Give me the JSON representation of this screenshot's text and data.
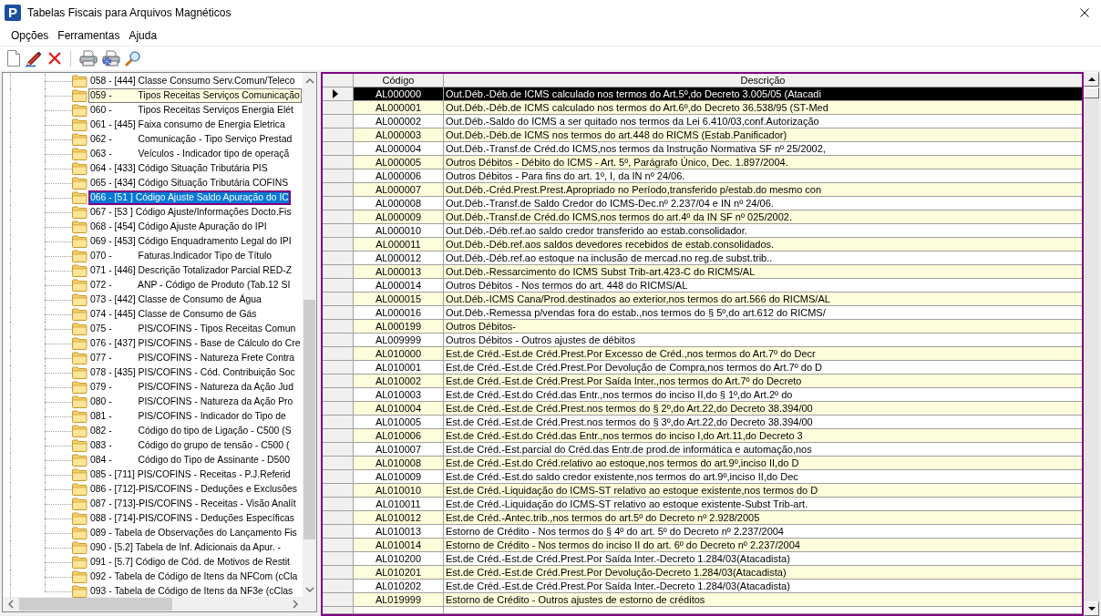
{
  "window": {
    "app_icon_text": "P",
    "title": "Tabelas Fiscais para Arquivos Magnéticos"
  },
  "menu": [
    "Opções",
    "Ferramentas",
    "Ajuda"
  ],
  "tree": {
    "items": [
      {
        "label": "058 - [444] Classe Consumo Serv.Comun/Teleco",
        "selected": false,
        "hovered": false
      },
      {
        "label": "059 -          Tipos Receitas Serviços Comunicação",
        "selected": false,
        "hovered": true
      },
      {
        "label": "060 -          Tipos Receitas Serviços Energia Elét",
        "selected": false,
        "hovered": false
      },
      {
        "label": "061 - [445] Faixa consumo de Energia Eletrica",
        "selected": false,
        "hovered": false
      },
      {
        "label": "062 -          Comunicação - Tipo Serviço Prestad",
        "selected": false,
        "hovered": false
      },
      {
        "label": "063 -          Veículos - Indicador tipo de operaçã",
        "selected": false,
        "hovered": false
      },
      {
        "label": "064 - [433] Código Situação Tributária PIS",
        "selected": false,
        "hovered": false
      },
      {
        "label": "065 - [434] Código Situação Tributária COFINS",
        "selected": false,
        "hovered": false
      },
      {
        "label": "066 - [51 ] Código Ajuste Saldo Apuração do IC",
        "selected": true,
        "hovered": false
      },
      {
        "label": "067 - [53 ] Código Ajuste/Informações Docto.Fis",
        "selected": false,
        "hovered": false
      },
      {
        "label": "068 - [454] Código Ajuste Apuração do IPI",
        "selected": false,
        "hovered": false
      },
      {
        "label": "069 - [453] Código Enquadramento Legal do IPI",
        "selected": false,
        "hovered": false
      },
      {
        "label": "070 -          Faturas.Indicador Tipo de Título",
        "selected": false,
        "hovered": false
      },
      {
        "label": "071 - [446] Descrição Totalizador Parcial RED-Z",
        "selected": false,
        "hovered": false
      },
      {
        "label": "072 -          ANP - Código de Produto (Tab.12 SI",
        "selected": false,
        "hovered": false
      },
      {
        "label": "073 - [442] Classe de Consumo de Água",
        "selected": false,
        "hovered": false
      },
      {
        "label": "074 - [445] Classe de Consumo de Gás",
        "selected": false,
        "hovered": false
      },
      {
        "label": "075 -          PIS/COFINS - Tipos Receitas Comun",
        "selected": false,
        "hovered": false
      },
      {
        "label": "076 - [437] PIS/COFINS - Base de Cálculo do Cre",
        "selected": false,
        "hovered": false
      },
      {
        "label": "077 -          PIS/COFINS - Natureza Frete Contra",
        "selected": false,
        "hovered": false
      },
      {
        "label": "078 - [435] PIS/COFINS - Cód. Contribuição Soc",
        "selected": false,
        "hovered": false
      },
      {
        "label": "079 -          PIS/COFINS - Natureza da Ação Jud",
        "selected": false,
        "hovered": false
      },
      {
        "label": "080 -          PIS/COFINS - Natureza da Ação Pro",
        "selected": false,
        "hovered": false
      },
      {
        "label": "081 -          PIS/COFINS - Indicador do Tipo de",
        "selected": false,
        "hovered": false
      },
      {
        "label": "082 -          Código do tipo de Ligação - C500 (S",
        "selected": false,
        "hovered": false
      },
      {
        "label": "083 -          Código do grupo de tensão - C500 (",
        "selected": false,
        "hovered": false
      },
      {
        "label": "084 -          Código do Tipo de Assinante - D500",
        "selected": false,
        "hovered": false
      },
      {
        "label": "085 - [711] PIS/COFINS - Receitas - P.J.Referid",
        "selected": false,
        "hovered": false
      },
      {
        "label": "086 - [712]-PIS/COFINS - Deduções e Exclusões",
        "selected": false,
        "hovered": false
      },
      {
        "label": "087 - [713]-PIS/COFINS - Receitas - Visão Analít",
        "selected": false,
        "hovered": false
      },
      {
        "label": "088 - [714]-PIS/COFINS - Deduções Específicas",
        "selected": false,
        "hovered": false
      },
      {
        "label": "089 - Tabela de Observações do Lançamento Fis",
        "selected": false,
        "hovered": false
      },
      {
        "label": "090 - [5.2] Tabela de Inf. Adicionais da Apur. -",
        "selected": false,
        "hovered": false
      },
      {
        "label": "091 - [5.7] Código de Cód. de Motivos de Restit",
        "selected": false,
        "hovered": false
      },
      {
        "label": "092 - Tabela de Código de Itens da NFCom (cCla",
        "selected": false,
        "hovered": false
      },
      {
        "label": "093 - Tabela de Código de Itens da NF3e (cClas",
        "selected": false,
        "hovered": false
      }
    ]
  },
  "table": {
    "columns": [
      "Código",
      "Descrição"
    ],
    "rows": [
      {
        "codigo": "AL000000",
        "descricao": "Out.Déb.-Déb.de ICMS calculado nos termos do Art.5º,do Decreto 3.005/05 (Atacadi",
        "selected": true
      },
      {
        "codigo": "AL000001",
        "descricao": "Out.Déb.-Déb.de ICMS calculado nos termos do Art.6º,do Decreto 36.538/95 (ST-Med",
        "selected": false
      },
      {
        "codigo": "AL000002",
        "descricao": "Out.Déb.-Saldo do ICMS a ser quitado nos termos da Lei 6.410/03,conf.Autorização",
        "selected": false
      },
      {
        "codigo": "AL000003",
        "descricao": "Out.Déb.-Déb.de ICMS nos termos do art.448 do RICMS (Estab.Panificador)",
        "selected": false
      },
      {
        "codigo": "AL000004",
        "descricao": "Out.Déb.-Transf.de Créd.do ICMS,nos termos da Instrução Normativa SF nº 25/2002,",
        "selected": false
      },
      {
        "codigo": "AL000005",
        "descricao": "Outros Débitos - Débito do ICMS - Art. 5º, Parágrafo Único, Dec. 1.897/2004.",
        "selected": false
      },
      {
        "codigo": "AL000006",
        "descricao": "Outros Débitos - Para fins do art. 1º, I, da IN nº 24/06.",
        "selected": false
      },
      {
        "codigo": "AL000007",
        "descricao": "Out.Déb.-Créd.Prest.Prest.Apropriado no Período,transferido p/estab.do mesmo con",
        "selected": false
      },
      {
        "codigo": "AL000008",
        "descricao": "Out.Déb.-Transf.de Saldo Credor do ICMS-Dec.nº 2.237/04 e IN nº 24/06.",
        "selected": false
      },
      {
        "codigo": "AL000009",
        "descricao": "Out.Déb.-Transf.de Créd.do ICMS,nos termos do art.4º da IN SF nº 025/2002.",
        "selected": false
      },
      {
        "codigo": "AL000010",
        "descricao": "Out.Déb.-Déb.ref.ao saldo credor transferido ao estab.consolidador.",
        "selected": false
      },
      {
        "codigo": "AL000011",
        "descricao": "Out.Déb.-Déb.ref.aos saldos devedores recebidos de estab.consolidados.",
        "selected": false
      },
      {
        "codigo": "AL000012",
        "descricao": "Out.Déb.-Déb.ref.ao estoque na inclusão de mercad.no reg.de subst.trib..",
        "selected": false
      },
      {
        "codigo": "AL000013",
        "descricao": "Out.Déb.-Ressarcimento do ICMS Subst Trib-art.423-C do RICMS/AL",
        "selected": false
      },
      {
        "codigo": "AL000014",
        "descricao": "Outros Débitos - Nos termos do art. 448 do RICMS/AL",
        "selected": false
      },
      {
        "codigo": "AL000015",
        "descricao": "Out.Déb.-ICMS Cana/Prod.destinados ao exterior,nos termos do art.566 do RICMS/AL",
        "selected": false
      },
      {
        "codigo": "AL000016",
        "descricao": "Out.Déb.-Remessa p/vendas fora do estab.,nos termos do § 5º,do art.612 do RICMS/",
        "selected": false
      },
      {
        "codigo": "AL000199",
        "descricao": "Outros Débitos-",
        "selected": false
      },
      {
        "codigo": "AL009999",
        "descricao": "Outros Débitos - Outros ajustes de débitos",
        "selected": false
      },
      {
        "codigo": "AL010000",
        "descricao": "Est.de Créd.-Est.de Créd.Prest.Por Excesso de Créd.,nos termos do Art.7º do Decr",
        "selected": false
      },
      {
        "codigo": "AL010001",
        "descricao": "Est.de Créd.-Est.de Créd.Prest.Por Devolução de Compra,nos termos do Art.7º do D",
        "selected": false
      },
      {
        "codigo": "AL010002",
        "descricao": "Est.de Créd.-Est.de Créd.Prest.Por Saída Inter.,nos termos do Art.7º do Decreto",
        "selected": false
      },
      {
        "codigo": "AL010003",
        "descricao": "Est.de Créd.-Est.do Créd.das Entr.,nos termos do inciso II,do § 1º,do Art.2º do",
        "selected": false
      },
      {
        "codigo": "AL010004",
        "descricao": "Est.de Créd.-Est.de Créd.Prest.nos termos do § 2º,do Art.22,do Decreto 38.394/00",
        "selected": false
      },
      {
        "codigo": "AL010005",
        "descricao": "Est.de Créd.-Est.de Créd.Prest.nos termos do § 3º,do Art.22,do Decreto 38.394/00",
        "selected": false
      },
      {
        "codigo": "AL010006",
        "descricao": "Est.de Créd.-Est.do Créd.das Entr.,nos termos do inciso I,do Art.11,do Decreto 3",
        "selected": false
      },
      {
        "codigo": "AL010007",
        "descricao": "Est.de Créd.-Est.parcial do Créd.das Entr.de prod.de informática e automação,nos",
        "selected": false
      },
      {
        "codigo": "AL010008",
        "descricao": "Est.de Créd.-Est.do Créd.relativo ao estoque,nos termos do art.9º,inciso II,do D",
        "selected": false
      },
      {
        "codigo": "AL010009",
        "descricao": "Est.de Créd.-Est.do saldo credor existente,nos termos do art.9º,inciso II,do Dec",
        "selected": false
      },
      {
        "codigo": "AL010010",
        "descricao": "Est.de Créd.-Liquidação do ICMS-ST relativo ao estoque existente,nos termos do D",
        "selected": false
      },
      {
        "codigo": "AL010011",
        "descricao": "Est.de Créd.-Liquidação do ICMS-ST relativo ao estoque existente-Subst Trib-art.",
        "selected": false
      },
      {
        "codigo": "AL010012",
        "descricao": "Est.de Créd.-Antec.trib.,nos termos do art.5º do Decreto nº 2.928/2005",
        "selected": false
      },
      {
        "codigo": "AL010013",
        "descricao": "Estorno de Crédito - Nos termos do  § 4º do art. 5º do Decreto nº 2.237/2004",
        "selected": false
      },
      {
        "codigo": "AL010014",
        "descricao": "Estorno de Crédito - Nos termos do inciso II do art. 6º do Decreto nº 2.237/2004",
        "selected": false
      },
      {
        "codigo": "AL010200",
        "descricao": "Est.de Créd.-Est.de Créd.Prest.Por Saída Inter.-Decreto 1.284/03(Atacadista)",
        "selected": false
      },
      {
        "codigo": "AL010201",
        "descricao": "Est.de Créd.-Est.de Créd.Prest.Por Devolução-Decreto 1.284/03(Atacadista)",
        "selected": false
      },
      {
        "codigo": "AL010202",
        "descricao": "Est.de Créd.-Est.de Créd.Prest.Por Saída Inter.-Decreto 1.284/03(Atacadista)",
        "selected": false
      },
      {
        "codigo": "AL019999",
        "descricao": "Estorno de Crédito - Outros ajustes de estorno de créditos",
        "selected": false
      }
    ]
  }
}
